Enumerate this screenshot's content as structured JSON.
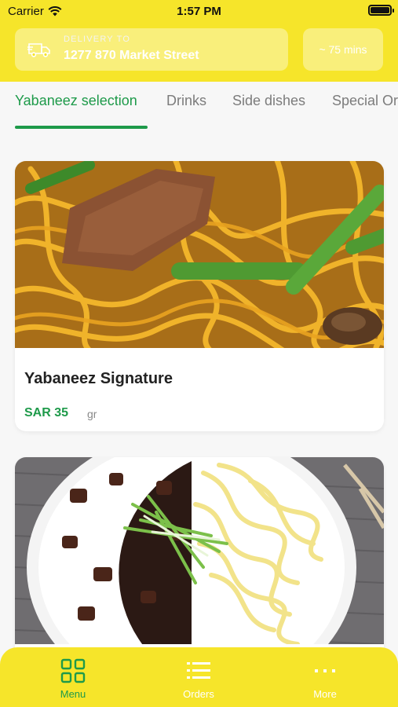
{
  "status_bar": {
    "carrier": "Carrier",
    "time": "1:57 PM"
  },
  "delivery": {
    "label": "DELIVERY TO",
    "address": "1277 870 Market Street",
    "eta": "~ 75 mins"
  },
  "tabs": [
    {
      "label": "Yabaneez selection",
      "active": true
    },
    {
      "label": "Drinks"
    },
    {
      "label": "Side dishes"
    },
    {
      "label": "Special Orders"
    }
  ],
  "items": [
    {
      "name": "Yabaneez Signature",
      "price": "SAR 35",
      "unit": "gr"
    }
  ],
  "bottom_nav": [
    {
      "label": "Menu",
      "active": true
    },
    {
      "label": "Orders"
    },
    {
      "label": "More"
    }
  ],
  "colors": {
    "brand_yellow": "#f6e52a",
    "accent_green": "#1e9a4a"
  }
}
